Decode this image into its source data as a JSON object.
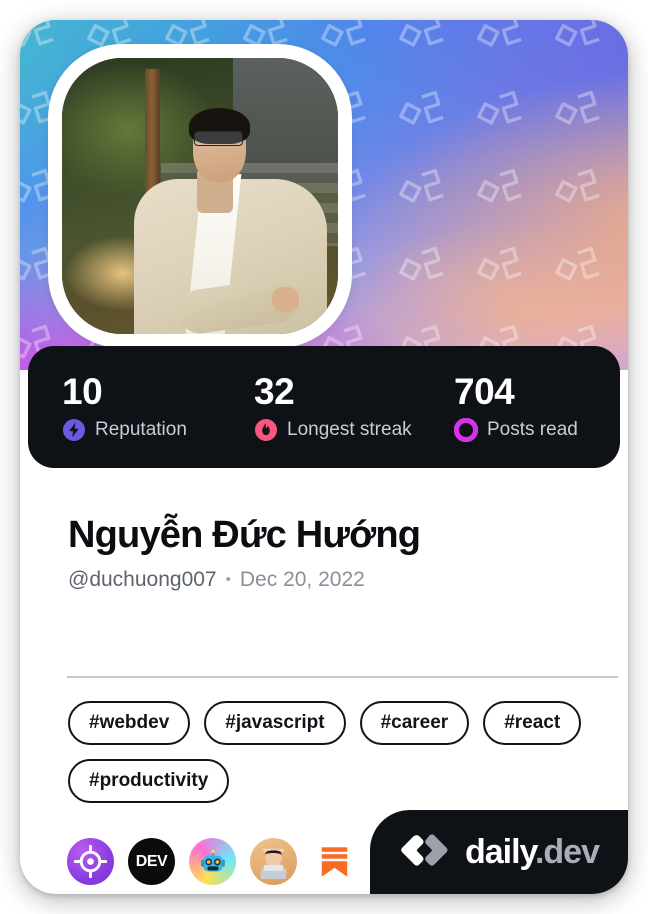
{
  "card": {
    "cover": {
      "pattern_icon": "daily-dev-logo-watermark",
      "gradient_colors": [
        "#3b9fe0",
        "#4e8ff0",
        "#7a8ee8",
        "#b79fd8",
        "#e342e9",
        "#f5b07d",
        "#49bace"
      ]
    },
    "avatar": {
      "alt": "Profile photo of Nguyễn Đức Hướng"
    },
    "stats": [
      {
        "value": "10",
        "label": "Reputation",
        "icon": "reputation-bolt-icon",
        "color": "#6a5ae0"
      },
      {
        "value": "32",
        "label": "Longest streak",
        "icon": "streak-flame-icon",
        "color": "#f8577f"
      },
      {
        "value": "704",
        "label": "Posts read",
        "icon": "posts-read-ring-icon",
        "color": "#d633e8"
      }
    ],
    "identity": {
      "name": "Nguyễn Đức Hướng",
      "handle": "@duchuong007",
      "separator": "•",
      "date": "Dec 20, 2022"
    },
    "tags": [
      "#webdev",
      "#javascript",
      "#career",
      "#react",
      "#productivity"
    ],
    "badges": [
      {
        "name": "badge-target-icon",
        "title": "target"
      },
      {
        "name": "badge-dev-icon",
        "title": "DEV"
      },
      {
        "name": "badge-robot-icon",
        "title": "robot avatar"
      },
      {
        "name": "badge-person-icon",
        "title": "person avatar"
      },
      {
        "name": "badge-bookmark-icon",
        "title": "bookmark"
      }
    ],
    "badge_dev_label": "DEV",
    "logo": {
      "mark": "daily-dev-chevron-logo",
      "word": "daily",
      "suffix": ".dev"
    }
  }
}
